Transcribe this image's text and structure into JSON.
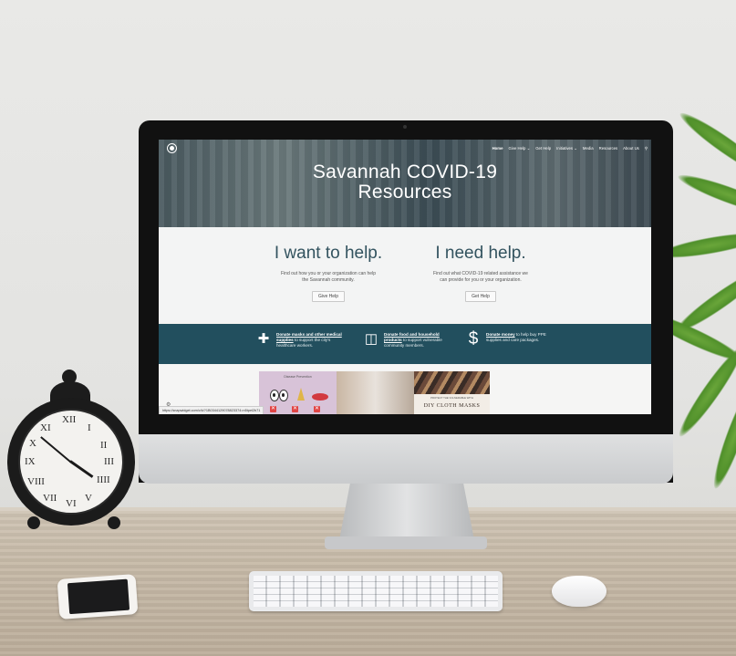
{
  "website": {
    "nav": {
      "items": [
        "Home",
        "Give Help ⌄",
        "Get Help",
        "Initiatives ⌄",
        "Media",
        "Resources",
        "About Us"
      ],
      "active": "Home"
    },
    "hero": {
      "title_line1": "Savannah COVID-19",
      "title_line2": "Resources"
    },
    "give_help": {
      "heading": "I want to help.",
      "text": "Find out how you or your organization can help the Savannah community.",
      "button": "Give Help"
    },
    "get_help": {
      "heading": "I need help.",
      "text": "Find out what COVID-19 related assistance we can provide for you or your organization.",
      "button": "Get Help"
    },
    "band": {
      "item1_link": "Donate masks and other medical supplies",
      "item1_rest": " to support the city's healthcare workers.",
      "item2_link": "Donate food and household products",
      "item2_rest": " to support vulnerable community members.",
      "item3_link": "Donate money",
      "item3_rest": " to help buy PPE supplies and care packages."
    },
    "gallery": {
      "tile1_caption": "Disease Prevention",
      "tile3_small": "PROTECT THE VULNERABLE WITH",
      "tile3_title": "DIY CLOTH MASKS"
    },
    "status_url": "https://snapwidget.com/v/k/?1B0344129078823374=n5tpel2b71"
  },
  "clock": {
    "numerals": [
      "XII",
      "I",
      "II",
      "III",
      "IIII",
      "V",
      "VI",
      "VII",
      "VIII",
      "IX",
      "X",
      "XI"
    ]
  },
  "icons": [
    "logo-icon",
    "search-icon",
    "first-aid-kit-icon",
    "jar-icon",
    "dollar-icon",
    "gear-icon"
  ],
  "colors": {
    "teal_band": "#224f5e",
    "heading_teal": "#33535f",
    "wall": "#e6e6e4",
    "desk": "#c6b9a7"
  }
}
